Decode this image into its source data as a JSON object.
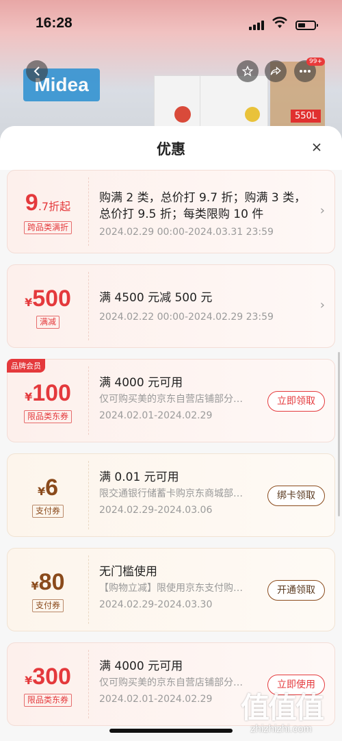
{
  "status_bar": {
    "time": "16:28"
  },
  "background": {
    "brand": "Midea",
    "tag": "550L"
  },
  "nav": {
    "badge": "99+"
  },
  "sheet": {
    "title": "优惠"
  },
  "coupons": [
    {
      "amount_prefix": "",
      "amount": "9",
      "amount_suffix": ".7折起",
      "tag": "跨品类满折",
      "title": "购满 2 类，总价打 9.7 折；购满 3 类，总价打 9.5 折；每类限购 10 件",
      "date": "2024.02.29 00:00-2024.03.31 23:59"
    },
    {
      "amount_prefix": "¥",
      "amount": "500",
      "amount_suffix": "",
      "tag": "满减",
      "title": "满 4500 元减 500 元",
      "date": "2024.02.22 00:00-2024.02.29 23:59"
    },
    {
      "member_tag": "品牌会员",
      "amount_prefix": "¥",
      "amount": "100",
      "amount_suffix": "",
      "tag": "限品类东券",
      "title": "满 4000 元可用",
      "desc": "仅可购买美的京东自营店铺部分商品",
      "date": "2024.02.01-2024.02.29",
      "action": "立即领取"
    },
    {
      "amount_prefix": "¥",
      "amount": "6",
      "amount_suffix": "",
      "tag": "支付券",
      "title": "满 0.01 元可用",
      "desc": "限交通银行储蓄卡购京东商城部分商品",
      "date": "2024.02.29-2024.03.06",
      "action": "绑卡领取"
    },
    {
      "amount_prefix": "¥",
      "amount": "80",
      "amount_suffix": "",
      "tag": "支付券",
      "title": "无门槛使用",
      "desc": "【购物立减】限使用京东支付购买部分商品",
      "date": "2024.02.29-2024.03.30",
      "action": "开通领取"
    },
    {
      "amount_prefix": "¥",
      "amount": "300",
      "amount_suffix": "",
      "tag": "限品类东券",
      "title": "满 4000 元可用",
      "desc": "仅可购买美的京东自营店铺部分商品",
      "date": "2024.02.01-2024.02.29",
      "action": "立即使用"
    }
  ],
  "watermark": {
    "text": "值值值",
    "sub": "zhizhizhi.com"
  }
}
